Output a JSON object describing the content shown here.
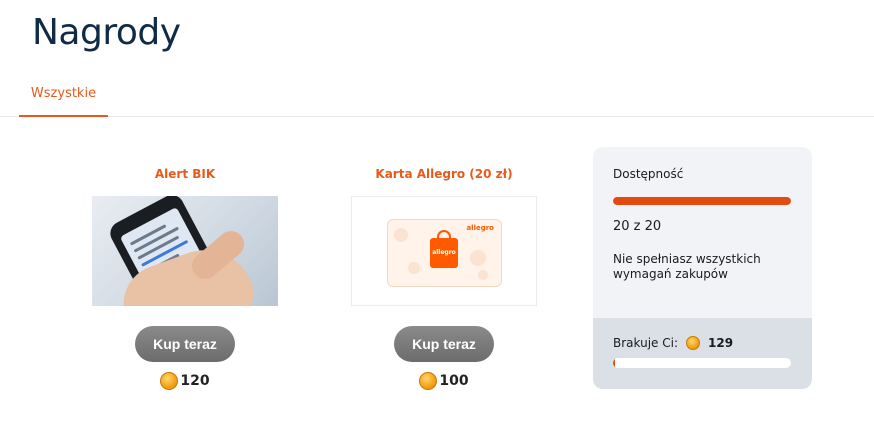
{
  "page": {
    "title": "Nagrody"
  },
  "tabs": [
    {
      "label": "Wszystkie",
      "active": true
    }
  ],
  "products": [
    {
      "title": "Alert BIK",
      "image": "phone-sms-photo",
      "button": "Kup teraz",
      "price": "120",
      "price_icon": "coin-icon"
    },
    {
      "title": "Karta Allegro (20 zł)",
      "image": "allegro-gift-card",
      "image_logo_text": "allegro",
      "button": "Kup teraz",
      "price": "100",
      "price_icon": "coin-icon"
    }
  ],
  "availability": {
    "label": "Dostępność",
    "count_text": "20 z 20",
    "fraction": 1.0,
    "note": "Nie spełniasz wszystkich wymagań zakupów"
  },
  "missing": {
    "label": "Brakuje Ci:",
    "value": "129",
    "fraction": 0.01
  },
  "colors": {
    "accent": "#e8591a",
    "title": "#0f2b46",
    "button": "#777777",
    "bar": "#e34a0d",
    "panel": "#f1f3f6",
    "panel_bottom": "#dbe0e6"
  }
}
